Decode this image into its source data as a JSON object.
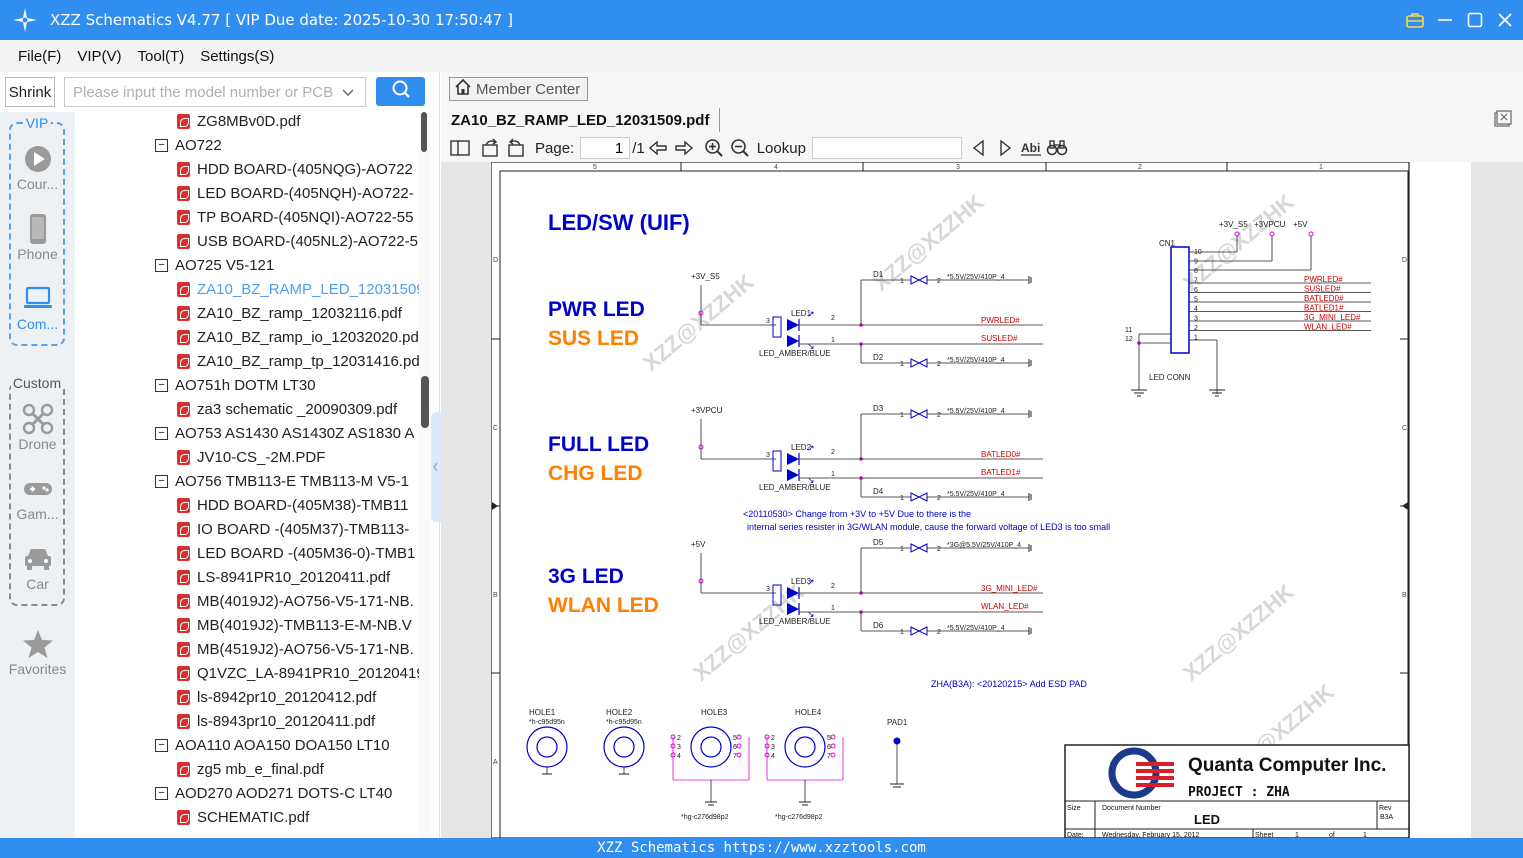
{
  "titlebar": {
    "title": "XZZ Schematics V4.77 [ VIP Due date: 2025-10-30 17:50:47 ]"
  },
  "menu": [
    "File(F)",
    "VIP(V)",
    "Tool(T)",
    "Settings(S)"
  ],
  "leftpane": {
    "shrink_label": "Shrink",
    "search_placeholder": "Please input the model number or PCB",
    "vip_label": "VIP",
    "custom_label": "Custom",
    "categories": [
      {
        "label": "Cour...",
        "icon": "play-icon",
        "active": false
      },
      {
        "label": "Phone",
        "icon": "phone-icon",
        "active": false
      },
      {
        "label": "Com...",
        "icon": "laptop-icon",
        "active": true
      },
      {
        "label": "Drone",
        "icon": "drone-icon",
        "active": false
      },
      {
        "label": "Gam...",
        "icon": "gamepad-icon",
        "active": false
      },
      {
        "label": "Car",
        "icon": "car-icon",
        "active": false
      },
      {
        "label": "Favorites",
        "icon": "star-icon",
        "active": false
      }
    ],
    "tree": [
      {
        "level": 2,
        "type": "file",
        "label": "ZG8MBv0D.pdf"
      },
      {
        "level": 1,
        "type": "folder",
        "label": "AO722"
      },
      {
        "level": 2,
        "type": "file",
        "label": "HDD BOARD-(405NQG)-AO722"
      },
      {
        "level": 2,
        "type": "file",
        "label": "LED BOARD-(405NQH)-AO722-"
      },
      {
        "level": 2,
        "type": "file",
        "label": "TP BOARD-(405NQI)-AO722-55"
      },
      {
        "level": 2,
        "type": "file",
        "label": "USB BOARD-(405NL2)-AO722-5"
      },
      {
        "level": 1,
        "type": "folder",
        "label": "AO725 V5-121"
      },
      {
        "level": 2,
        "type": "file",
        "label": "ZA10_BZ_RAMP_LED_12031509.",
        "selected": true
      },
      {
        "level": 2,
        "type": "file",
        "label": "ZA10_BZ_ramp_12032116.pdf"
      },
      {
        "level": 2,
        "type": "file",
        "label": "ZA10_BZ_ramp_io_12032020.pd"
      },
      {
        "level": 2,
        "type": "file",
        "label": "ZA10_BZ_ramp_tp_12031416.pd"
      },
      {
        "level": 1,
        "type": "folder",
        "label": "AO751h DOTM LT30"
      },
      {
        "level": 2,
        "type": "file",
        "label": "za3 schematic _20090309.pdf"
      },
      {
        "level": 1,
        "type": "folder",
        "label": "AO753 AS1430 AS1430Z AS1830 A"
      },
      {
        "level": 2,
        "type": "file",
        "label": "JV10-CS_-2M.PDF"
      },
      {
        "level": 1,
        "type": "folder",
        "label": "AO756 TMB113-E TMB113-M V5-1"
      },
      {
        "level": 2,
        "type": "file",
        "label": "HDD BOARD-(405M38)-TMB11"
      },
      {
        "level": 2,
        "type": "file",
        "label": "IO BOARD -(405M37)-TMB113-"
      },
      {
        "level": 2,
        "type": "file",
        "label": "LED BOARD -(405M36-0)-TMB1"
      },
      {
        "level": 2,
        "type": "file",
        "label": "LS-8941PR10_20120411.pdf"
      },
      {
        "level": 2,
        "type": "file",
        "label": "MB(4019J2)-AO756-V5-171-NB."
      },
      {
        "level": 2,
        "type": "file",
        "label": "MB(4019J2)-TMB113-E-M-NB.V"
      },
      {
        "level": 2,
        "type": "file",
        "label": "MB(4519J2)-AO756-V5-171-NB."
      },
      {
        "level": 2,
        "type": "file",
        "label": "Q1VZC_LA-8941PR10_20120419"
      },
      {
        "level": 2,
        "type": "file",
        "label": "ls-8942pr10_20120412.pdf"
      },
      {
        "level": 2,
        "type": "file",
        "label": "ls-8943pr10_20120411.pdf"
      },
      {
        "level": 1,
        "type": "folder",
        "label": "AOA110 AOA150 DOA150 LT10"
      },
      {
        "level": 2,
        "type": "file",
        "label": "zg5 mb_e_final.pdf"
      },
      {
        "level": 1,
        "type": "folder",
        "label": "AOD270 AOD271 DOTS-C LT40"
      },
      {
        "level": 2,
        "type": "file",
        "label": "SCHEMATIC.pdf"
      }
    ]
  },
  "rightpane": {
    "member_center": "Member Center",
    "doc_tab": "ZA10_BZ_RAMP_LED_12031509.pdf",
    "toolbar": {
      "page_label": "Page:",
      "page_value": "1",
      "page_total": "/1",
      "lookup_label": "Lookup"
    }
  },
  "schematic": {
    "heading": "LED/SW (UIF)",
    "groups": [
      {
        "label1": "PWR LED",
        "label2": "SUS LED",
        "rail": "+3V_S5",
        "led": "LED1",
        "part": "LED_AMBER/BLUE",
        "d_top": "D1",
        "d_bot": "D2",
        "sig1": "PWRLED#",
        "sig2": "SUSLED#"
      },
      {
        "label1": "FULL LED",
        "label2": "CHG LED",
        "rail": "+3VPCU",
        "led": "LED2",
        "part": "LED_AMBER/BLUE",
        "d_top": "D3",
        "d_bot": "D4",
        "sig1": "BATLED0#",
        "sig2": "BATLED1#"
      },
      {
        "label1": "3G LED",
        "label2": "WLAN LED",
        "rail": "+5V",
        "led": "LED3",
        "part": "LED_AMBER/BLUE",
        "d_top": "D5",
        "d_bot": "D6",
        "sig1": "3G_MINI_LED#",
        "sig2": "WLAN_LED#"
      }
    ],
    "diode_value": "*5.5V/25V/410P_4",
    "diode_value_3g": "*3G@5.5V/25V/410P_4",
    "note1": "<20110530> Change from +3V to +5V Due to there is the",
    "note2": "internal series resister in 3G/WLAN module, cause the forward voltage of LED3 is too small",
    "note3": "ZHA(B3A): <20120215> Add ESD PAD",
    "connector": {
      "ref": "CN1",
      "name": "LED CONN",
      "rails": [
        "+3V_S5",
        "+3VPCU",
        "+5V"
      ],
      "pins": [
        "10",
        "9",
        "8",
        "7",
        "6",
        "5",
        "4",
        "3",
        "2",
        "1"
      ],
      "extra_pins": [
        "11",
        "12"
      ],
      "signals": [
        "PWRLED#",
        "SUSLED#",
        "BATLED0#",
        "BATLED1#",
        "3G_MINI_LED#",
        "WLAN_LED#"
      ]
    },
    "holes": [
      {
        "ref": "HOLE1",
        "val": "*h-c95d95n"
      },
      {
        "ref": "HOLE2",
        "val": "*h-c95d95n"
      },
      {
        "ref": "HOLE3",
        "val": "*hg-c276d98p2"
      },
      {
        "ref": "HOLE4",
        "val": "*hg-c276d98p2"
      }
    ],
    "pad": "PAD1",
    "company": "Quanta Computer Inc.",
    "project": "PROJECT : ZHA",
    "size_label": "Size",
    "doc_number_label": "Document Number",
    "rev_label": "Rev",
    "rev_value": "B3A",
    "doc_title": "LED",
    "date_label": "Date:",
    "date_value": "Wednesday, February 15, 2012",
    "sheet_label": "Sheet",
    "sheet_value": "1",
    "of_label": "of",
    "of_value": "1",
    "watermark": "XZZ@XZZHK",
    "ruler_top": [
      "5",
      "4",
      "3",
      "2",
      "1"
    ],
    "ruler_side": [
      "D",
      "C",
      "B",
      "A"
    ]
  },
  "statusbar": "XZZ Schematics https://www.xzztools.com",
  "colors": {
    "accent": "#2f8ef0",
    "schematic_blue": "#0000cc",
    "schematic_orange": "#ff7f00",
    "signal_red": "#cc0000",
    "node_magenta": "#e000e0"
  }
}
